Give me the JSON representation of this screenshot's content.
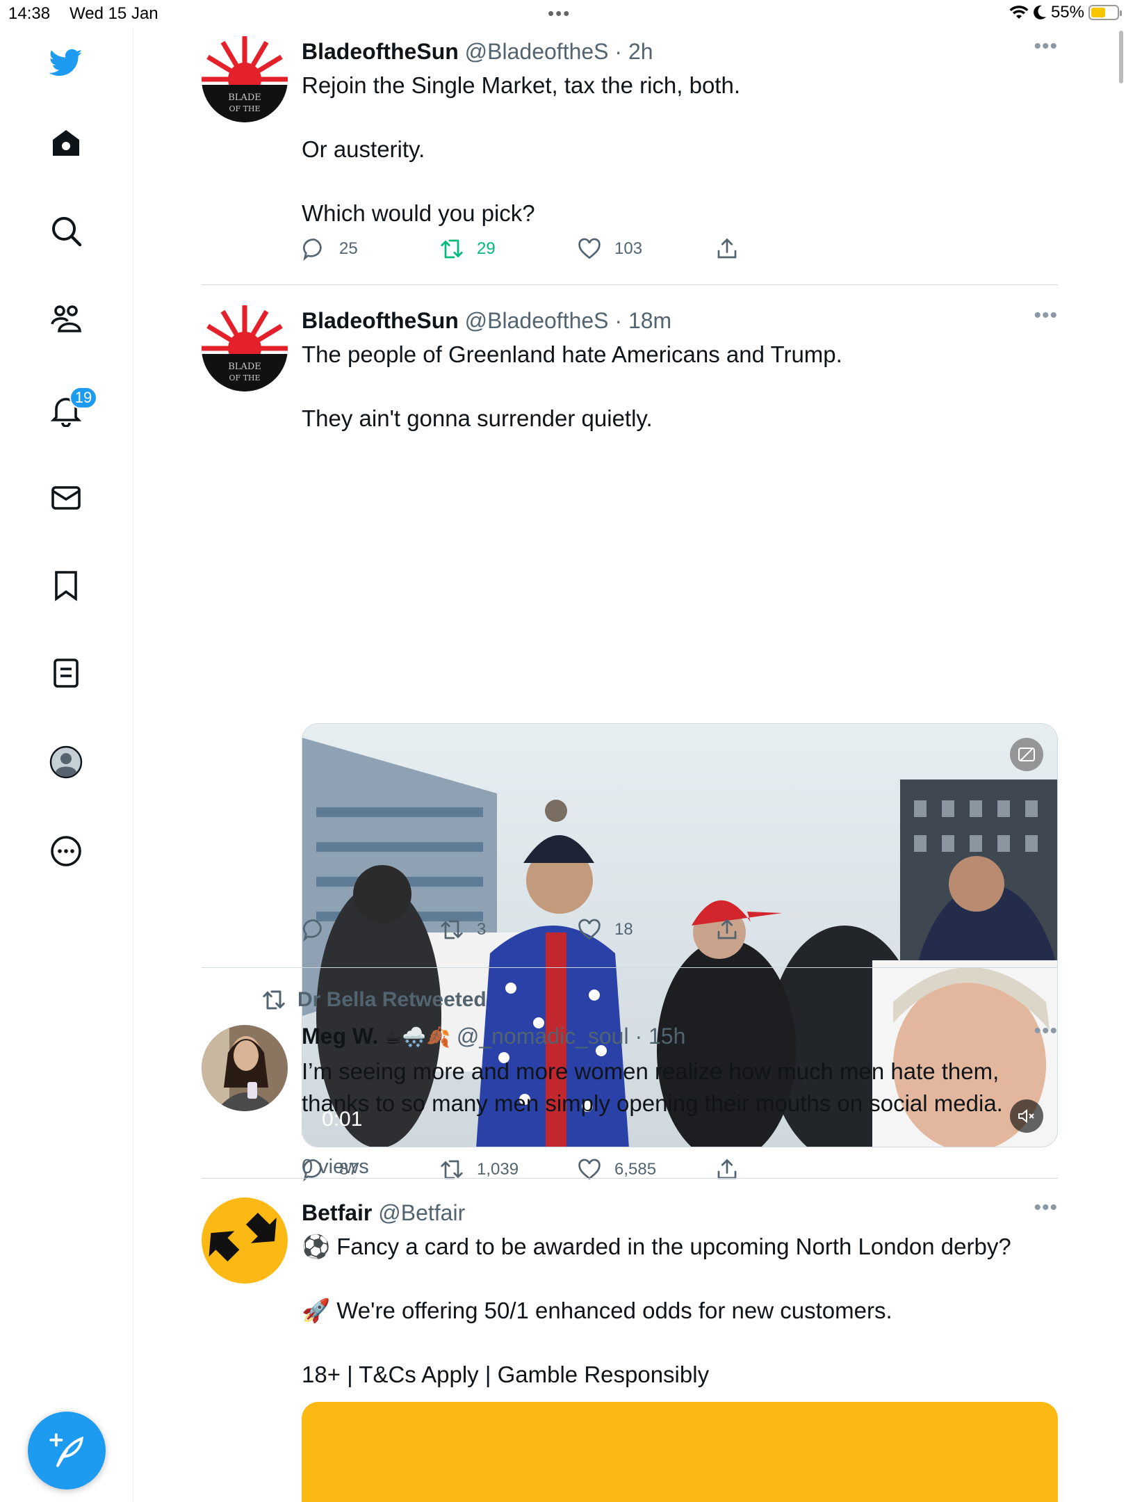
{
  "status_bar": {
    "time": "14:38",
    "date": "Wed 15 Jan",
    "battery": "55%",
    "battery_level": 0.55
  },
  "sidebar": {
    "notifications_count": "19",
    "accent": "#1d9bf0"
  },
  "tweets": [
    {
      "name": "BladeoftheSun",
      "handle": "@BladeoftheS",
      "time": "· 2h",
      "lines": [
        "Rejoin the Single Market, tax the rich, both.",
        "Or austerity.",
        "Which would you pick?"
      ],
      "replies": "25",
      "retweets": "29",
      "likes": "103"
    },
    {
      "name": "BladeoftheSun",
      "handle": "@BladeoftheS",
      "time": "· 18m",
      "lines": [
        "The people of Greenland hate Americans and Trump.",
        "They ain't gonna surrender quietly."
      ],
      "video_time": "0:01",
      "views": "0 views",
      "replies": "",
      "retweets": "3",
      "likes": "18"
    },
    {
      "retweeted_by": "Dr Bella Retweeted",
      "name": "Meg W.",
      "emojis": "☕🌨️🍂",
      "handle": "@_nomadic_soul",
      "time": "· 15h",
      "lines": [
        "I’m seeing more and more women realize how much men hate them,",
        "thanks to so many men simply opening their mouths on social media."
      ],
      "replies": "87",
      "retweets": "1,039",
      "likes": "6,585"
    },
    {
      "name": "Betfair",
      "handle": "@Betfair",
      "lines": [
        "⚽ Fancy a card to be awarded in the upcoming North London derby?",
        "🚀 We're offering 50/1 enhanced odds for new customers.",
        "18+ | T&Cs Apply | Gamble Responsibly"
      ]
    }
  ]
}
